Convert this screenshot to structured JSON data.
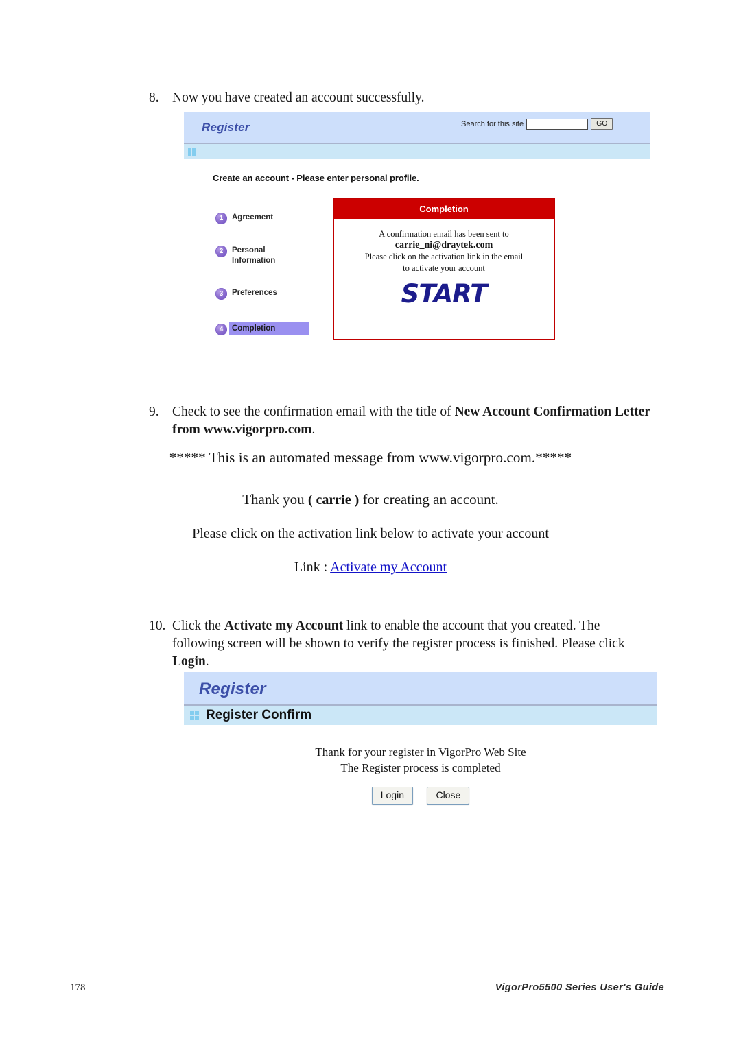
{
  "document": {
    "footer": {
      "page_number": "178",
      "guide_title": "VigorPro5500 Series User's Guide"
    }
  },
  "steps": {
    "step8": {
      "number": "8.",
      "text": "Now you have created an account successfully."
    },
    "step9": {
      "number": "9.",
      "text_before": "Check to see the confirmation email with the title of ",
      "text_bold": "New Account Confirmation Letter from www.vigorpro.com",
      "text_after": "."
    },
    "step10": {
      "number": "10.",
      "text_1": "Click the ",
      "bold_1": "Activate my Account",
      "text_2": " link to enable the account that you created. The following screen will be shown to verify the register process is finished. Please click ",
      "bold_2": "Login",
      "text_3": "."
    }
  },
  "screenshot_register": {
    "banner_title": "Register",
    "search_label": "Search for this site",
    "search_value": "",
    "search_placeholder": "",
    "go_button": "GO",
    "grid_icon": "grid-squares-icon",
    "heading": "Create an account - Please enter personal profile.",
    "wizard": [
      {
        "num": "1",
        "label": "Agreement",
        "active": false
      },
      {
        "num": "2",
        "label": "Personal\nInformation",
        "active": false
      },
      {
        "num": "3",
        "label": "Preferences",
        "active": false
      },
      {
        "num": "4",
        "label": "Completion",
        "active": true
      }
    ],
    "completion_panel": {
      "title": "Completion",
      "line1": "A confirmation email has been sent to",
      "email": "carrie_ni@draytek.com",
      "line2": "Please click on the activation link in the email",
      "line3": "to activate your account",
      "logo": "START"
    },
    "colors": {
      "banner_bg": "#cddffb",
      "subbar_bg": "#cbe7f7",
      "banner_title": "#3c4fa8",
      "completion_red": "#cc0000",
      "wizard_highlight": "#9a90f0",
      "start_navy": "#1c1c8c"
    }
  },
  "email_message": {
    "automated": "***** This is an automated message from www.vigorpro.com.*****",
    "thank_before": "Thank you ",
    "thank_name": "( carrie )",
    "thank_after": " for creating an account.",
    "instruction": "Please click on the activation link below to activate your account",
    "link_label": "Link : ",
    "link_text": "Activate my Account"
  },
  "screenshot_confirm": {
    "banner_title": "Register",
    "grid_icon": "grid-squares-icon",
    "subbar_title": "Register Confirm",
    "body_line1": "Thank for your register in VigorPro Web Site",
    "body_line2": "The Register process is completed",
    "buttons": [
      {
        "label": "Login",
        "name": "login-button"
      },
      {
        "label": "Close",
        "name": "close-button"
      }
    ]
  }
}
